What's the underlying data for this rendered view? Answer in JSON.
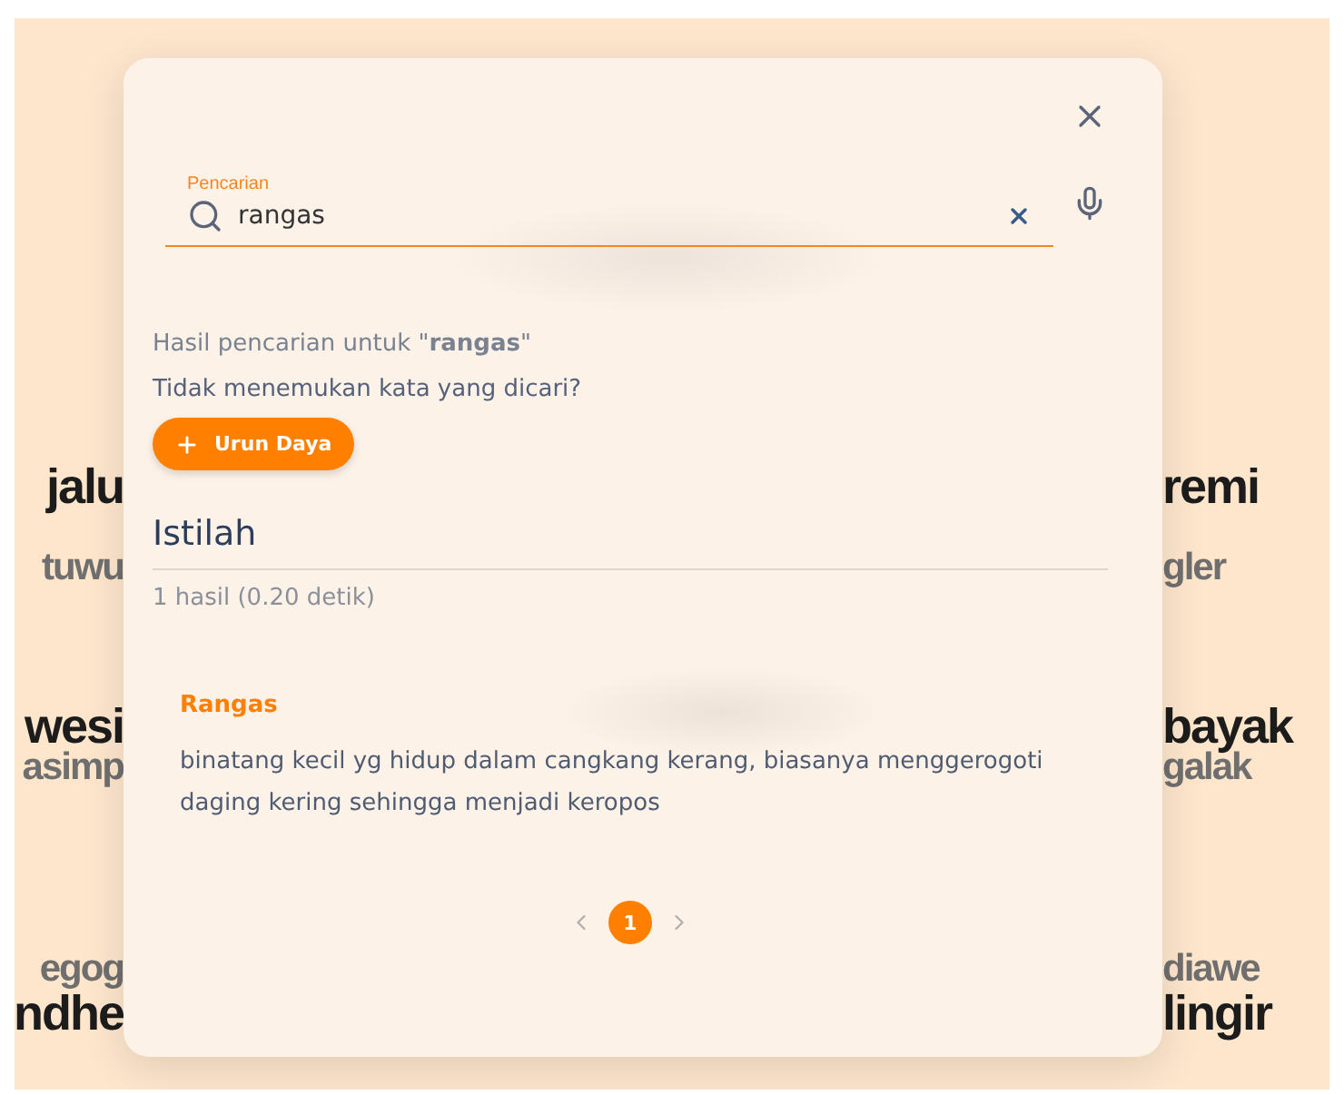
{
  "background_words_left": [
    "jalu",
    "tuwu",
    "wesi",
    "asimp",
    "egog",
    "ndhe"
  ],
  "background_words_right": [
    "remi",
    "gler",
    "bayak",
    "galak",
    "diawe",
    "lingir"
  ],
  "search": {
    "label": "Pencarian",
    "value": "rangas"
  },
  "result_summary": "Hasil pencarian untuk \"**rangas**\"",
  "not_found_prompt": "Tidak menemukan kata yang dicari?",
  "contribute_button": "Urun Daya",
  "section_title": "Istilah",
  "result_count": "1 hasil (0.20 detik)",
  "entries": [
    {
      "term": "Rangas",
      "definition": "binatang kecil yg hidup dalam cangkang kerang, biasanya menggerogoti daging kering sehingga menjadi keropos"
    }
  ],
  "pagination": {
    "pages": [
      {
        "label": "1",
        "selected": true
      }
    ]
  }
}
